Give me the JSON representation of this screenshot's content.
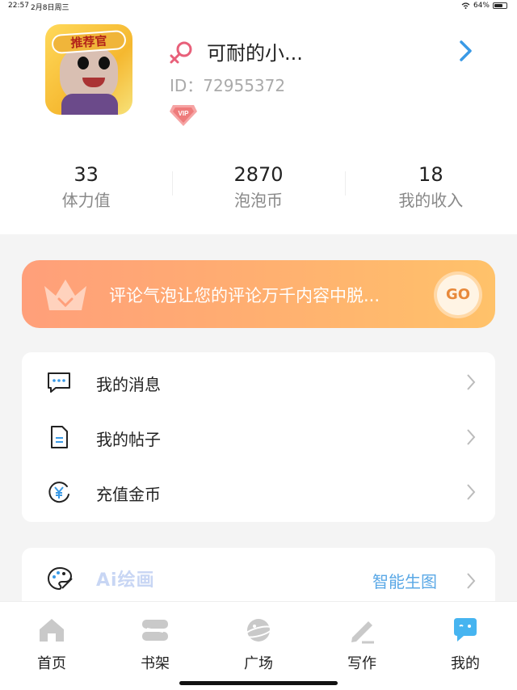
{
  "status": {
    "time": "22:57",
    "date": "2月8日周三",
    "battery": "64%"
  },
  "profile": {
    "badge": "推荐官",
    "username": "可耐的小...",
    "id_label": "ID：72955372",
    "vip": "VIP"
  },
  "stats": [
    {
      "value": "33",
      "label": "体力值"
    },
    {
      "value": "2870",
      "label": "泡泡币"
    },
    {
      "value": "18",
      "label": "我的收入"
    }
  ],
  "banner": {
    "text": "评论气泡让您的评论万千内容中脱...",
    "go": "GO"
  },
  "menu": [
    {
      "label": "我的消息",
      "icon": "message-icon"
    },
    {
      "label": "我的帖子",
      "icon": "document-icon"
    },
    {
      "label": "充值金币",
      "icon": "yuan-coin-icon"
    }
  ],
  "ai_card": {
    "title": "Ai绘画",
    "subtitle": "智能生图"
  },
  "tabs": [
    {
      "label": "首页",
      "icon": "home-icon"
    },
    {
      "label": "书架",
      "icon": "bookshelf-icon"
    },
    {
      "label": "广场",
      "icon": "planet-icon"
    },
    {
      "label": "写作",
      "icon": "pencil-icon"
    },
    {
      "label": "我的",
      "icon": "chat-bubble-icon",
      "active": true
    }
  ],
  "colors": {
    "accent": "#4aa3e8",
    "banner_start": "#ff9f7a",
    "banner_end": "#ffc26a",
    "gender": "#e8607a"
  }
}
